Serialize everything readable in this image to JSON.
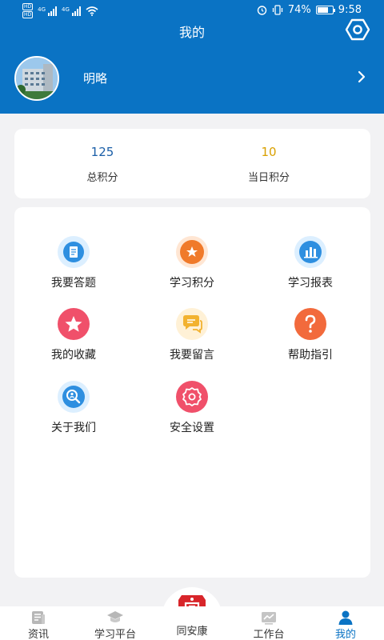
{
  "status_bar": {
    "hd_labels": [
      "HD",
      "HD"
    ],
    "network_labels": [
      "4G",
      "4G"
    ],
    "battery_percent": "74%",
    "battery_level": 0.74,
    "time": "9:58"
  },
  "header": {
    "title": "我的",
    "username": "明略"
  },
  "scores": {
    "total_value": "125",
    "total_label": "总积分",
    "today_value": "10",
    "today_label": "当日积分"
  },
  "menu": {
    "items": [
      {
        "label": "我要答题",
        "icon": "answer-sheet-icon",
        "color": "#2e8fe0"
      },
      {
        "label": "学习积分",
        "icon": "star-badge-icon",
        "color": "#f07a2a"
      },
      {
        "label": "学习报表",
        "icon": "bar-report-icon",
        "color": "#2e8fe0"
      },
      {
        "label": "我的收藏",
        "icon": "favorite-star-icon",
        "color": "#f0506a"
      },
      {
        "label": "我要留言",
        "icon": "message-bubble-icon",
        "color": "#f2b230"
      },
      {
        "label": "帮助指引",
        "icon": "help-question-icon",
        "color": "#f26a3c"
      },
      {
        "label": "关于我们",
        "icon": "about-magnifier-icon",
        "color": "#2e8fe0"
      },
      {
        "label": "安全设置",
        "icon": "security-gear-icon",
        "color": "#f0506a"
      }
    ]
  },
  "tabbar": {
    "tabs": [
      {
        "label": "资讯",
        "icon": "news-icon"
      },
      {
        "label": "学习平台",
        "icon": "graduation-cap-icon"
      },
      {
        "label": "同安康",
        "icon": "center-logo-icon"
      },
      {
        "label": "工作台",
        "icon": "workbench-chart-icon"
      },
      {
        "label": "我的",
        "icon": "person-icon"
      }
    ],
    "active_index": 4
  },
  "colors": {
    "primary": "#0a73c4",
    "total_score": "#1b5fa8",
    "today_score": "#d9a000",
    "background": "#f2f2f4"
  }
}
